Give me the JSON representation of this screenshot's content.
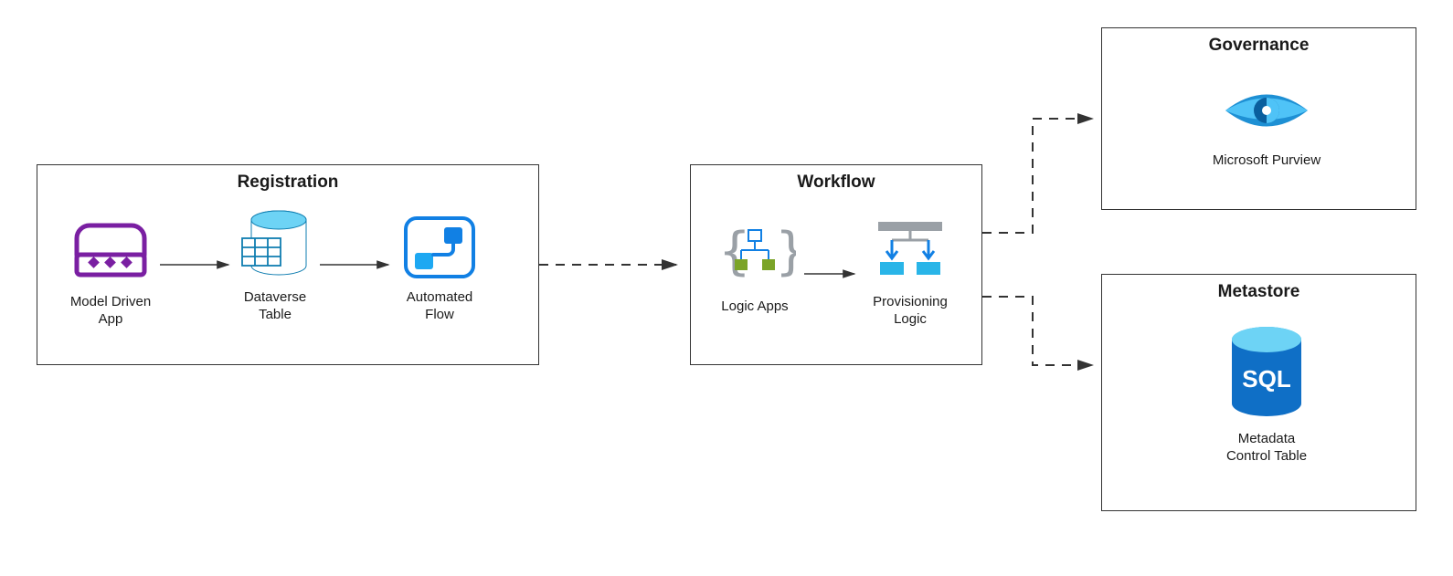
{
  "boxes": {
    "registration": {
      "title": "Registration"
    },
    "workflow": {
      "title": "Workflow"
    },
    "governance": {
      "title": "Governance"
    },
    "metastore": {
      "title": "Metastore"
    }
  },
  "items": {
    "model_driven_app": {
      "label": "Model Driven\nApp"
    },
    "dataverse_table": {
      "label": "Dataverse\nTable"
    },
    "automated_flow": {
      "label": "Automated\nFlow"
    },
    "logic_apps": {
      "label": "Logic Apps"
    },
    "provisioning": {
      "label": "Provisioning\nLogic"
    },
    "purview": {
      "label": "Microsoft Purview"
    },
    "metadata_table": {
      "label": "Metadata\nControl Table"
    }
  }
}
